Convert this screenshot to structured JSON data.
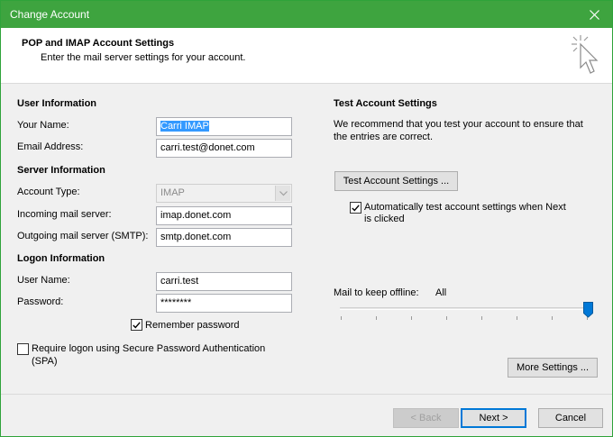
{
  "window": {
    "title": "Change Account"
  },
  "header": {
    "title": "POP and IMAP Account Settings",
    "subtitle": "Enter the mail server settings for your account."
  },
  "user_info": {
    "heading": "User Information",
    "name_label": "Your Name:",
    "name_value": "Carri IMAP",
    "email_label": "Email Address:",
    "email_value": "carri.test@donet.com"
  },
  "server_info": {
    "heading": "Server Information",
    "account_type_label": "Account Type:",
    "account_type_value": "IMAP",
    "incoming_label": "Incoming mail server:",
    "incoming_value": "imap.donet.com",
    "outgoing_label": "Outgoing mail server (SMTP):",
    "outgoing_value": "smtp.donet.com"
  },
  "logon_info": {
    "heading": "Logon Information",
    "username_label": "User Name:",
    "username_value": "carri.test",
    "password_label": "Password:",
    "password_value": "********",
    "remember_label": "Remember password",
    "remember_checked": true,
    "spa_label_line1": "Require logon using Secure Password Authentication",
    "spa_label_line2": "(SPA)",
    "spa_checked": false
  },
  "test_settings": {
    "heading": "Test Account Settings",
    "desc_line1": "We recommend that you test your account to ensure that",
    "desc_line2": "the entries are correct.",
    "test_button": "Test Account Settings ...",
    "auto_test_line1": "Automatically test account settings when Next",
    "auto_test_line2": "is clicked",
    "auto_test_checked": true
  },
  "offline": {
    "label": "Mail to keep offline:",
    "value": "All",
    "slider_level_percent": 100
  },
  "more_settings_button": "More Settings ...",
  "footer": {
    "back_button": "< Back",
    "next_button": "Next >",
    "cancel_button": "Cancel"
  },
  "colors": {
    "titlebar": "#3ea43f",
    "selection": "#3399ff",
    "slider_thumb": "#0078d7"
  },
  "icons": {
    "close": "close-icon",
    "header_graphic": "cursor-click-icon",
    "dropdown": "chevron-down-icon",
    "check": "checkmark-icon"
  }
}
